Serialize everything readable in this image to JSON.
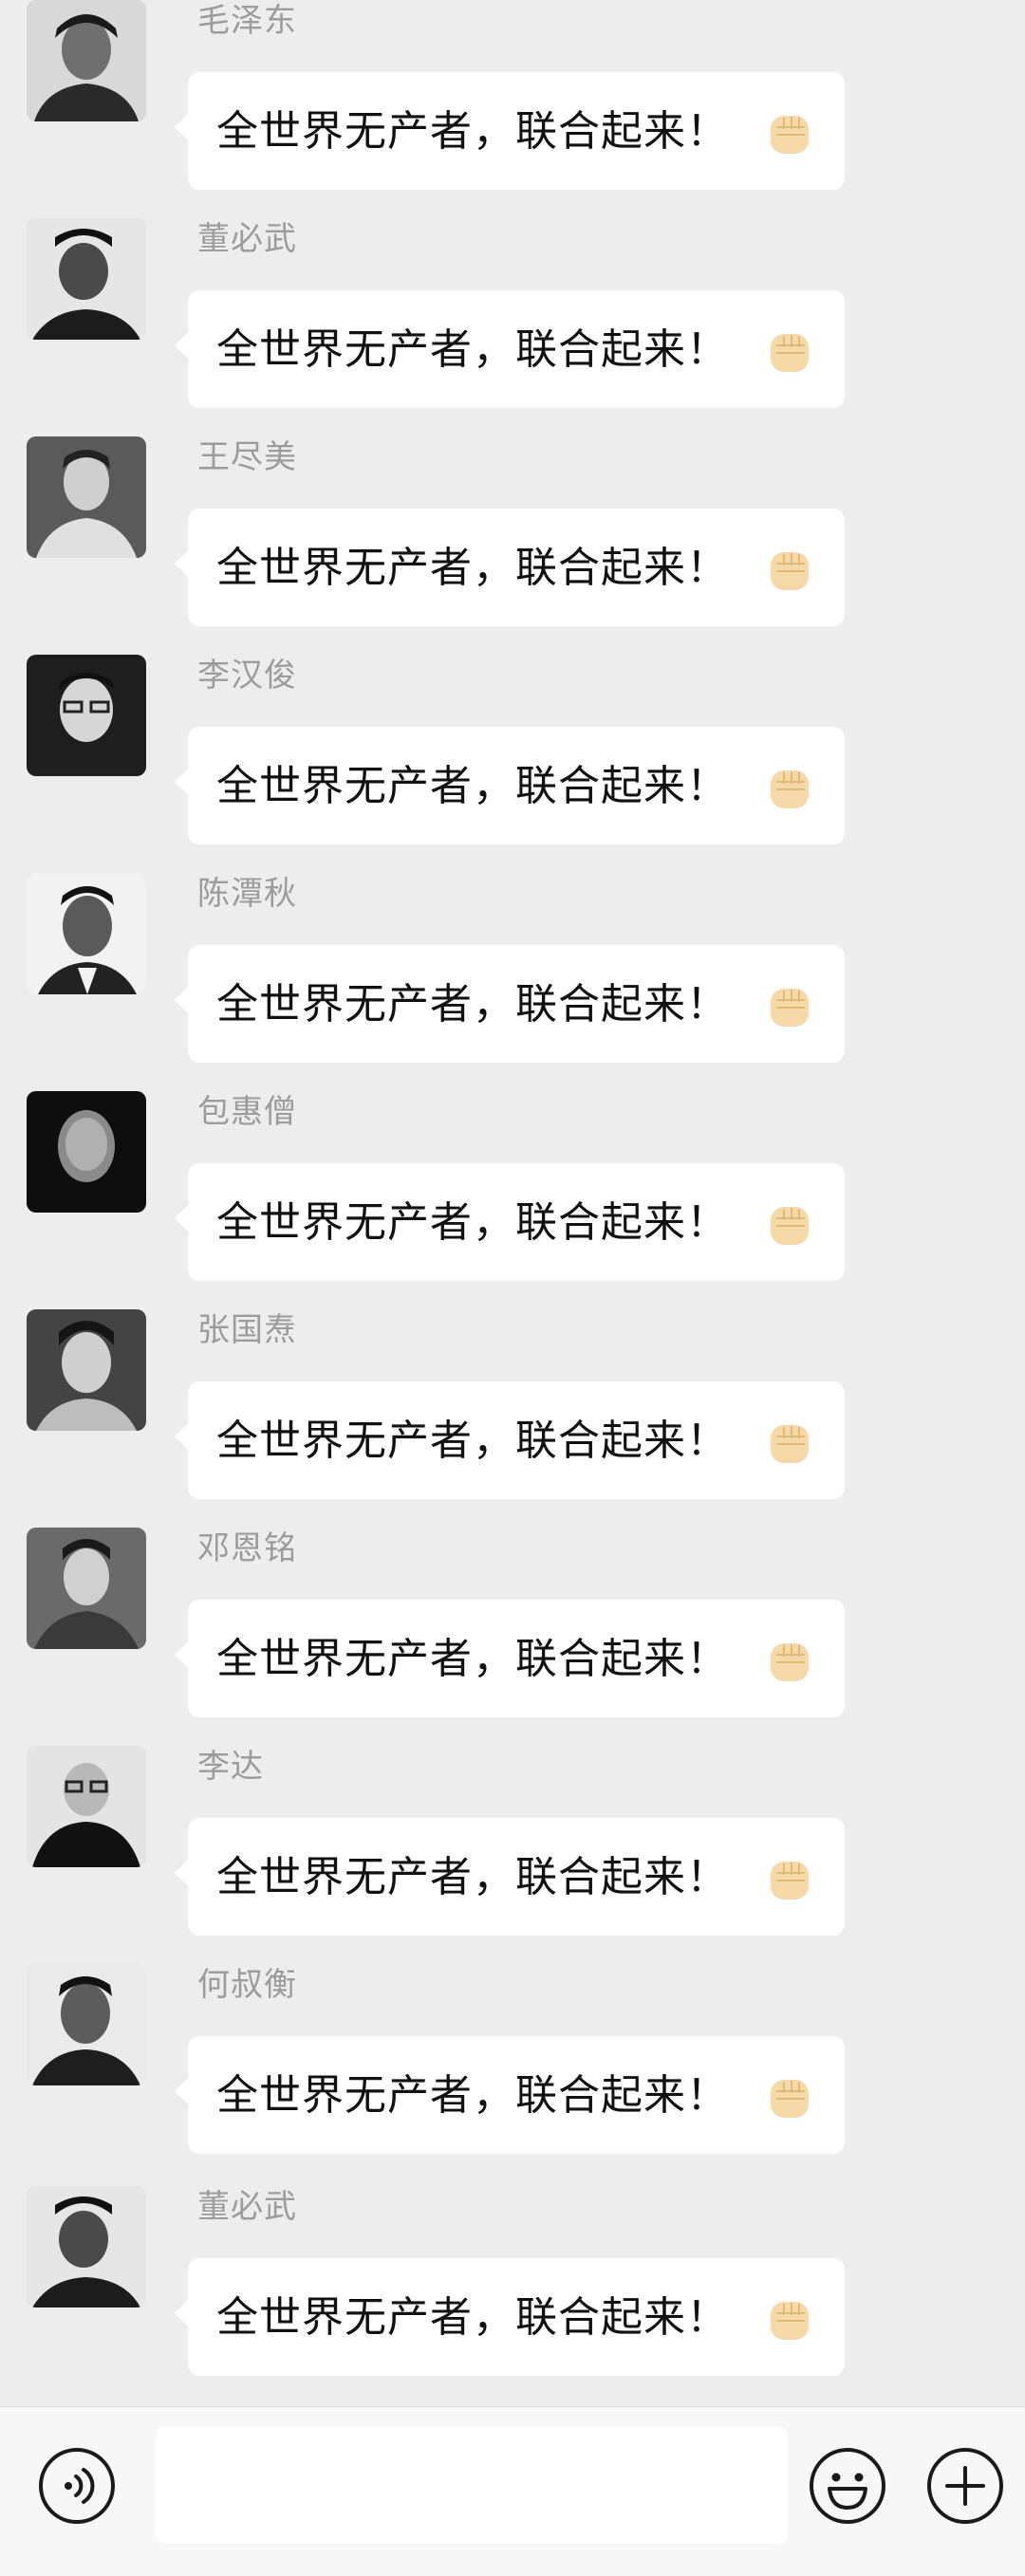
{
  "chat": {
    "messages": [
      {
        "sender": "毛泽东",
        "text": "全世界无产者，联合起来！",
        "emoji": "fist-icon"
      },
      {
        "sender": "董必武",
        "text": "全世界无产者，联合起来！",
        "emoji": "fist-icon"
      },
      {
        "sender": "王尽美",
        "text": "全世界无产者，联合起来！",
        "emoji": "fist-icon"
      },
      {
        "sender": "李汉俊",
        "text": "全世界无产者，联合起来！",
        "emoji": "fist-icon"
      },
      {
        "sender": "陈潭秋",
        "text": "全世界无产者，联合起来！",
        "emoji": "fist-icon"
      },
      {
        "sender": "包惠僧",
        "text": "全世界无产者，联合起来！",
        "emoji": "fist-icon"
      },
      {
        "sender": "张国焘",
        "text": "全世界无产者，联合起来！",
        "emoji": "fist-icon"
      },
      {
        "sender": "邓恩铭",
        "text": "全世界无产者，联合起来！",
        "emoji": "fist-icon"
      },
      {
        "sender": "李达",
        "text": "全世界无产者，联合起来！",
        "emoji": "fist-icon"
      },
      {
        "sender": "何叔衡",
        "text": "全世界无产者，联合起来！",
        "emoji": "fist-icon"
      },
      {
        "sender": "董必武",
        "text": "全世界无产者，联合起来！",
        "emoji": "fist-icon"
      }
    ]
  },
  "input_bar": {
    "value": "",
    "voice_icon": "voice-icon",
    "emoji_icon": "smiley-icon",
    "plus_icon": "plus-icon"
  },
  "colors": {
    "background": "#ededed",
    "bubble": "#ffffff",
    "sender_name": "#9c9c9c",
    "fist": "#f6d9a8"
  }
}
